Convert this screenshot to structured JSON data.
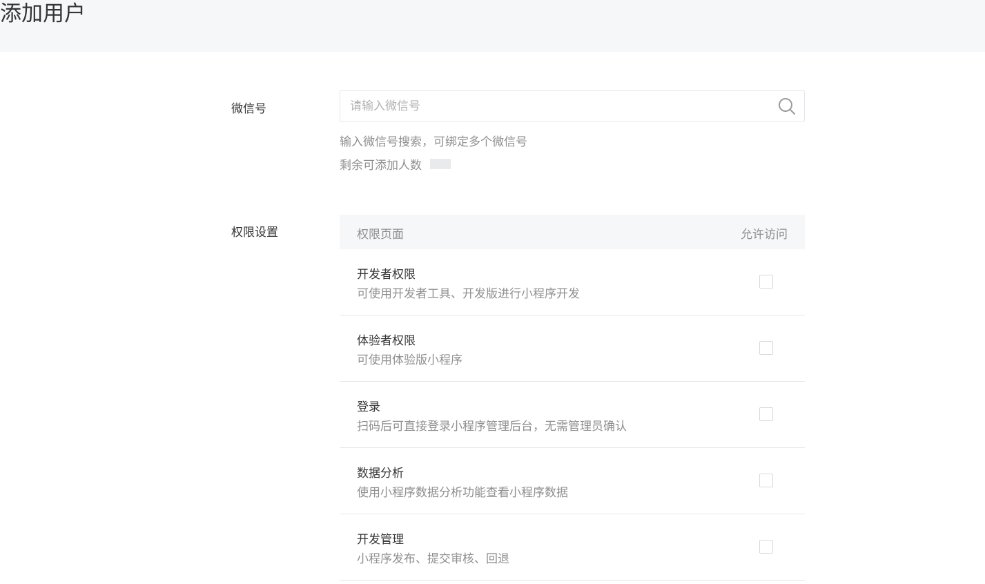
{
  "header": {
    "title": "添加用户"
  },
  "form": {
    "wechat_label": "微信号",
    "search_placeholder": "请输入微信号",
    "search_value": "",
    "hint_search": "输入微信号搜索，可绑定多个微信号",
    "hint_remaining": "剩余可添加人数",
    "permissions_label": "权限设置"
  },
  "permissions": {
    "col_page": "权限页面",
    "col_allow": "允许访问",
    "rows": [
      {
        "name": "开发者权限",
        "desc": "可使用开发者工具、开发版进行小程序开发",
        "checked": false
      },
      {
        "name": "体验者权限",
        "desc": "可使用体验版小程序",
        "checked": false
      },
      {
        "name": "登录",
        "desc": "扫码后可直接登录小程序管理后台，无需管理员确认",
        "checked": false
      },
      {
        "name": "数据分析",
        "desc": "使用小程序数据分析功能查看小程序数据",
        "checked": false
      },
      {
        "name": "开发管理",
        "desc": "小程序发布、提交审核、回退",
        "checked": false
      }
    ]
  },
  "icons": {
    "search": "search-icon",
    "checkbox": "checkbox-icon"
  }
}
